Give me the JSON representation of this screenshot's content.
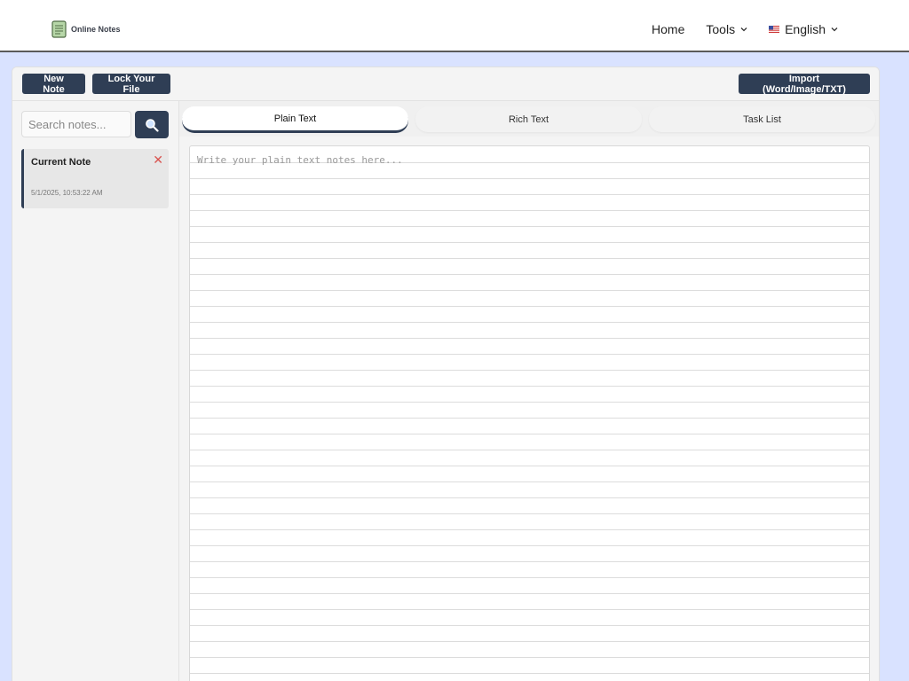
{
  "header": {
    "logo_text": "Online Notes",
    "nav": {
      "home": "Home",
      "tools": "Tools",
      "language": "English"
    }
  },
  "toolbar": {
    "new_note": "New Note",
    "lock_file": "Lock Your File",
    "import": "Import (Word/Image/TXT)"
  },
  "sidebar": {
    "search_placeholder": "Search notes...",
    "notes": [
      {
        "title": "Current Note",
        "date": "5/1/2025, 10:53:22 AM"
      }
    ]
  },
  "tabs": [
    {
      "label": "Plain Text",
      "active": true
    },
    {
      "label": "Rich Text",
      "active": false
    },
    {
      "label": "Task List",
      "active": false
    }
  ],
  "editor": {
    "placeholder": "Write your plain text notes here...",
    "value": ""
  },
  "colors": {
    "primary": "#2f3e55",
    "page_bg": "#d9e2ff",
    "close": "#d9534f"
  }
}
